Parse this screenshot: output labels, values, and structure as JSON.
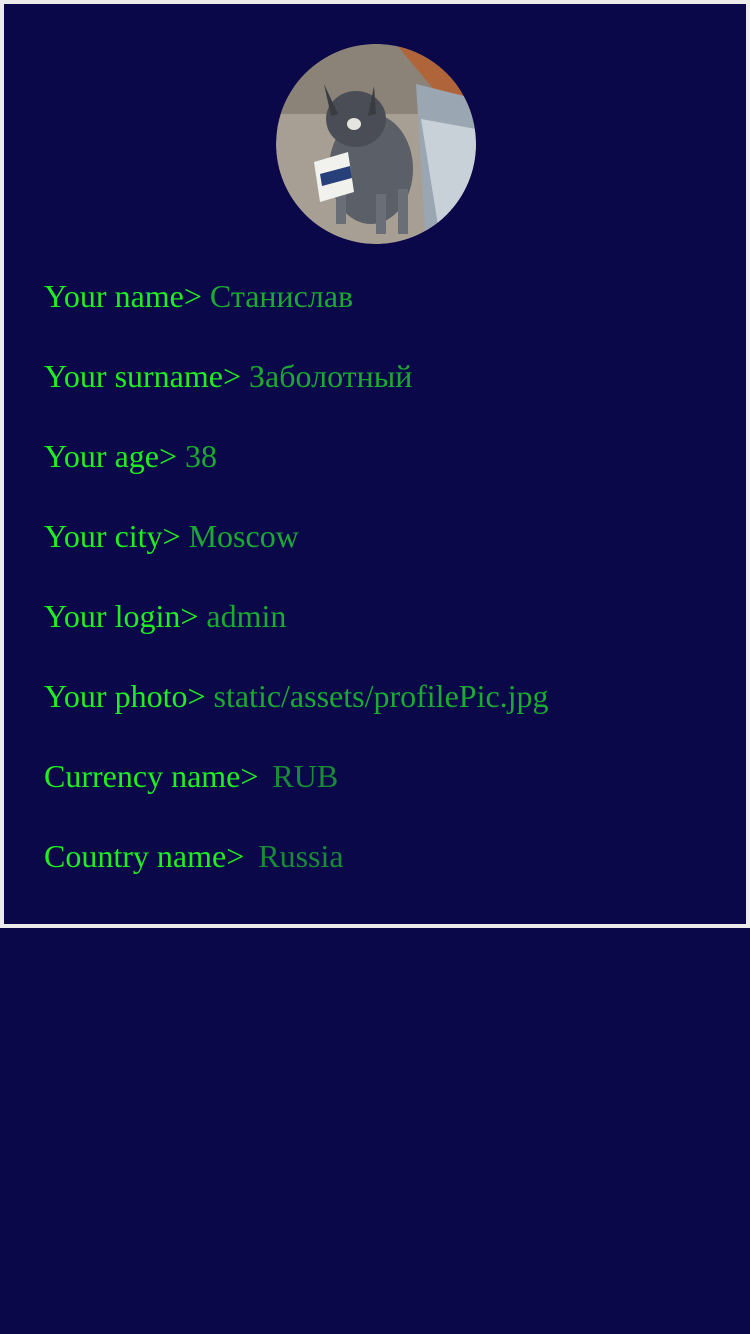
{
  "colors": {
    "background": "#0a0848",
    "card_border": "#ececec",
    "label": "#21ee21",
    "value": "#1da833",
    "value_dim": "#1b8a38"
  },
  "profile": {
    "avatar_alt": "profile photo",
    "fields": [
      {
        "label": "Your name>",
        "value": "Станислав"
      },
      {
        "label": "Your surname>",
        "value": "Заболотный"
      },
      {
        "label": "Your age>",
        "value": "38"
      },
      {
        "label": "Your city>",
        "value": "Moscow"
      },
      {
        "label": "Your login>",
        "value": "admin"
      },
      {
        "label": "Your photo>",
        "value": "static/assets/profilePic.jpg"
      },
      {
        "label": "Currency name>",
        "value": "RUB"
      },
      {
        "label": "Country name>",
        "value": "Russia"
      }
    ]
  }
}
